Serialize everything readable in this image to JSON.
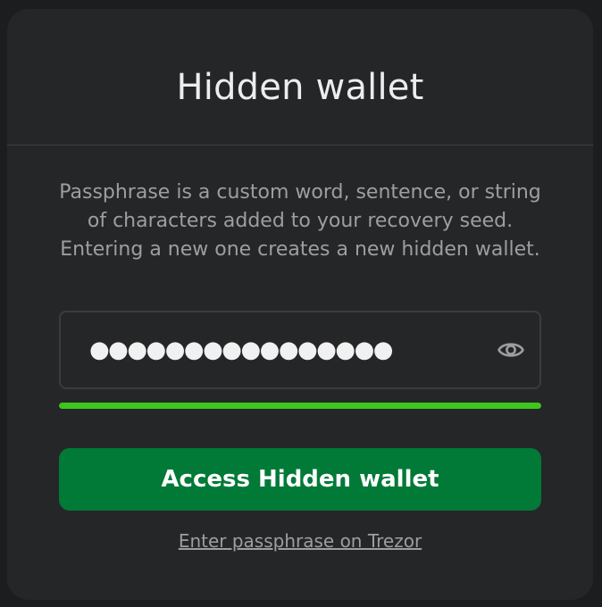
{
  "modal": {
    "title": "Hidden wallet",
    "description": "Passphrase is a custom word, sentence, or string of characters added to your recovery seed. Entering a new one creates a new hidden wallet.",
    "passphrase_input": {
      "masked_value": "●●●●●●●●●●●●●●●●",
      "toggle_icon": "eye-icon"
    },
    "strength_meter": {
      "level": 1.0,
      "color": "#3ec51f"
    },
    "submit_label": "Access Hidden wallet",
    "submit_color": "#017a37",
    "alt_link_label": "Enter passphrase on Trezor"
  }
}
